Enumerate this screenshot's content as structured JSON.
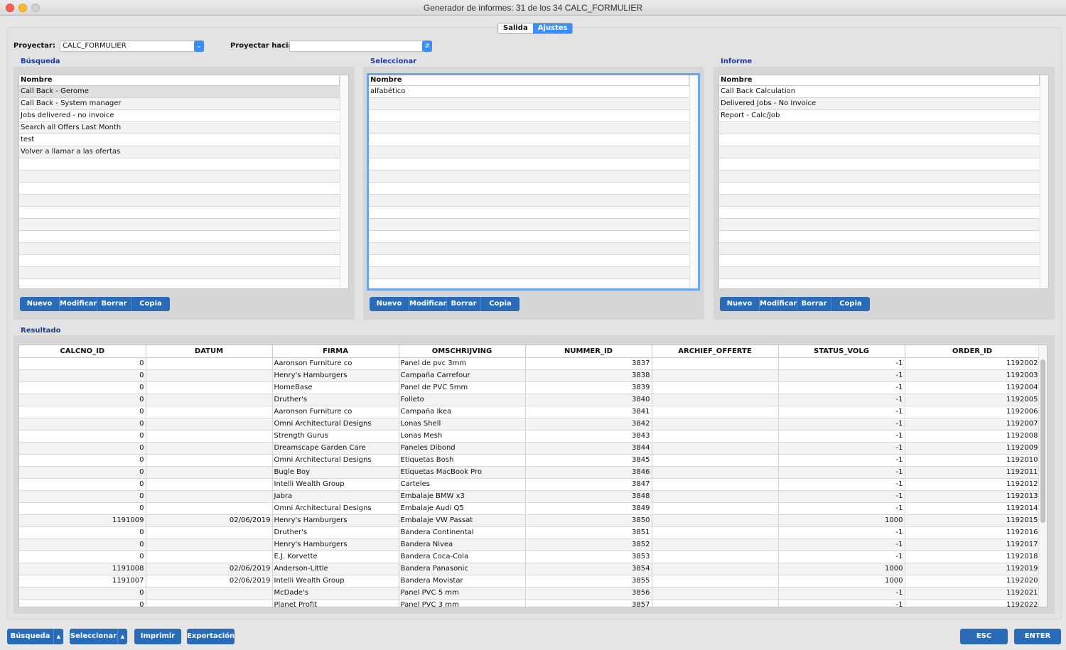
{
  "window": {
    "title": "Generador de informes: 31 de los 34 CALC_FORMULIER"
  },
  "tabs": [
    {
      "label": "Salida",
      "active": false
    },
    {
      "label": "Ajustes",
      "active": true
    }
  ],
  "project": {
    "label": "Proyectar:",
    "value": "CALC_FORMULIER",
    "to_label": "Proyectar hacia:",
    "to_value": ""
  },
  "busqueda": {
    "title": "Búsqueda",
    "header": "Nombre",
    "items": [
      "Call Back - Gerome",
      "Call Back - System manager",
      "Jobs delivered - no invoice",
      "Search all Offers Last Month",
      "test",
      "Volver a llamar a las ofertas"
    ]
  },
  "seleccionar": {
    "title": "Seleccionar",
    "header": "Nombre",
    "items": [
      "alfabético"
    ]
  },
  "informe": {
    "title": "Informe",
    "header": "Nombre",
    "items": [
      "Call Back Calculation",
      "Delivered Jobs - No Invoice",
      "Report - Calc/Job"
    ]
  },
  "actions": {
    "nuevo": "Nuevo",
    "modificar": "Modificar",
    "borrar": "Borrar",
    "copia": "Copia"
  },
  "resultado": {
    "title": "Resultado",
    "columns": [
      "CALCNO_ID",
      "DATUM",
      "FIRMA",
      "OMSCHRIJVING",
      "NUMMER_ID",
      "ARCHIEF_OFFERTE",
      "STATUS_VOLG",
      "ORDER_ID"
    ],
    "rows": [
      [
        "0",
        "",
        "Aaronson Furniture co",
        "Panel de pvc 3mm",
        "3837",
        "",
        "-1",
        "1192002"
      ],
      [
        "0",
        "",
        "Henry's Hamburgers",
        "Campaña Carrefour",
        "3838",
        "",
        "-1",
        "1192003"
      ],
      [
        "0",
        "",
        "HomeBase",
        "Panel de PVC 5mm",
        "3839",
        "",
        "-1",
        "1192004"
      ],
      [
        "0",
        "",
        "Druther's",
        "Folleto",
        "3840",
        "",
        "-1",
        "1192005"
      ],
      [
        "0",
        "",
        "Aaronson Furniture co",
        "Campaña Ikea",
        "3841",
        "",
        "-1",
        "1192006"
      ],
      [
        "0",
        "",
        "Omni Architectural Designs",
        "Lonas Shell",
        "3842",
        "",
        "-1",
        "1192007"
      ],
      [
        "0",
        "",
        "Strength Gurus",
        "Lonas Mesh",
        "3843",
        "",
        "-1",
        "1192008"
      ],
      [
        "0",
        "",
        "Dreamscape Garden Care",
        "Paneles Dibond",
        "3844",
        "",
        "-1",
        "1192009"
      ],
      [
        "0",
        "",
        "Omni Architectural Designs",
        "Etiquetas Bosh",
        "3845",
        "",
        "-1",
        "1192010"
      ],
      [
        "0",
        "",
        "Bugle Boy",
        "Etiquetas MacBook Pro",
        "3846",
        "",
        "-1",
        "1192011"
      ],
      [
        "0",
        "",
        "Intelli Wealth Group",
        "Carteles",
        "3847",
        "",
        "-1",
        "1192012"
      ],
      [
        "0",
        "",
        "Jabra",
        "Embalaje BMW x3",
        "3848",
        "",
        "-1",
        "1192013"
      ],
      [
        "0",
        "",
        "Omni Architectural Designs",
        "Embalaje Audi Q5",
        "3849",
        "",
        "-1",
        "1192014"
      ],
      [
        "1191009",
        "02/06/2019",
        "Henry's Hamburgers",
        "Embalaje VW Passat",
        "3850",
        "",
        "1000",
        "1192015"
      ],
      [
        "0",
        "",
        "Druther's",
        "Bandera Continental",
        "3851",
        "",
        "-1",
        "1192016"
      ],
      [
        "0",
        "",
        "Henry's Hamburgers",
        "Bandera Nivea",
        "3852",
        "",
        "-1",
        "1192017"
      ],
      [
        "0",
        "",
        "E.J. Korvette",
        "Bandera Coca-Cola",
        "3853",
        "",
        "-1",
        "1192018"
      ],
      [
        "1191008",
        "02/06/2019",
        "Anderson-Little",
        "Bandera Panasonic",
        "3854",
        "",
        "1000",
        "1192019"
      ],
      [
        "1191007",
        "02/06/2019",
        "Intelli Wealth Group",
        "Bandera Movistar",
        "3855",
        "",
        "1000",
        "1192020"
      ],
      [
        "0",
        "",
        "McDade's",
        "Panel PVC 5 mm",
        "3856",
        "",
        "-1",
        "1192021"
      ],
      [
        "0",
        "",
        "Planet Profit",
        "Panel PVC 3 mm",
        "3857",
        "",
        "-1",
        "1192022"
      ]
    ]
  },
  "footer": {
    "busqueda": "Búsqueda",
    "seleccionar": "Seleccionar",
    "imprimir": "Imprimir",
    "exportacion": "Exportación",
    "esc": "ESC",
    "enter": "ENTER"
  },
  "colors": {
    "accent": "#3d8ef7",
    "button": "#2a6bb8",
    "section_title": "#1d3d9c"
  }
}
